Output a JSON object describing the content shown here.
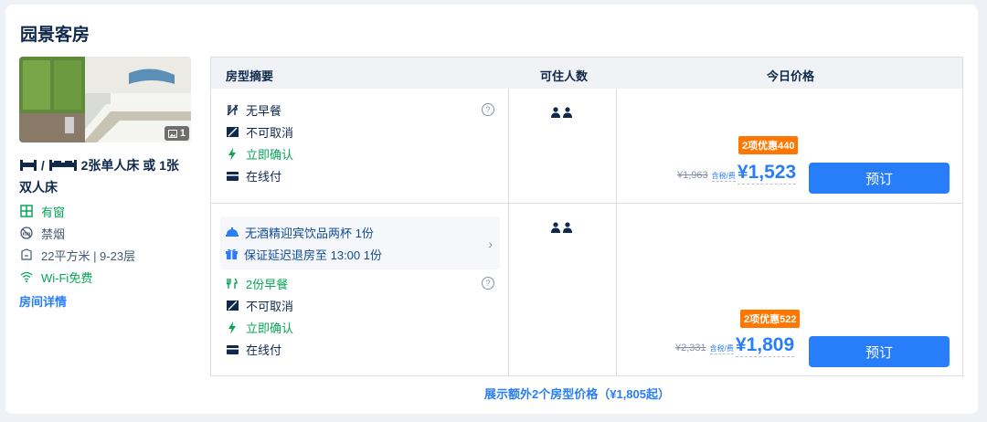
{
  "room": {
    "title": "园景客房",
    "photo_count": "1",
    "bed": "2张单人床 或 1张双人床",
    "features": [
      "有窗",
      "禁烟",
      "22平方米 | 9-23层",
      "Wi-Fi免费"
    ],
    "details_link": "房间详情"
  },
  "table": {
    "headers": {
      "summary": "房型摘要",
      "guests": "可住人数",
      "price": "今日价格"
    },
    "rows": [
      {
        "policies": [
          "无早餐",
          "不可取消",
          "立即确认",
          "在线付"
        ],
        "promo": "2项优惠440",
        "old_price": "¥1,963",
        "tax_label": "含税/费",
        "price": "¥1,523",
        "book": "预订"
      },
      {
        "perks": [
          "无酒精迎宾饮品两杯 1份",
          "保证延迟退房至 13:00 1份"
        ],
        "policies": [
          "2份早餐",
          "不可取消",
          "立即确认",
          "在线付"
        ],
        "promo": "2项优惠522",
        "old_price": "¥2,331",
        "tax_label": "含税/费",
        "price": "¥1,809",
        "book": "预订"
      }
    ]
  },
  "more_link": "展示额外2个房型价格（¥1,805起）",
  "colors": {
    "accent": "#287dfa",
    "green": "#06a559",
    "promo": "#ff7700",
    "text": "#0f294d"
  }
}
